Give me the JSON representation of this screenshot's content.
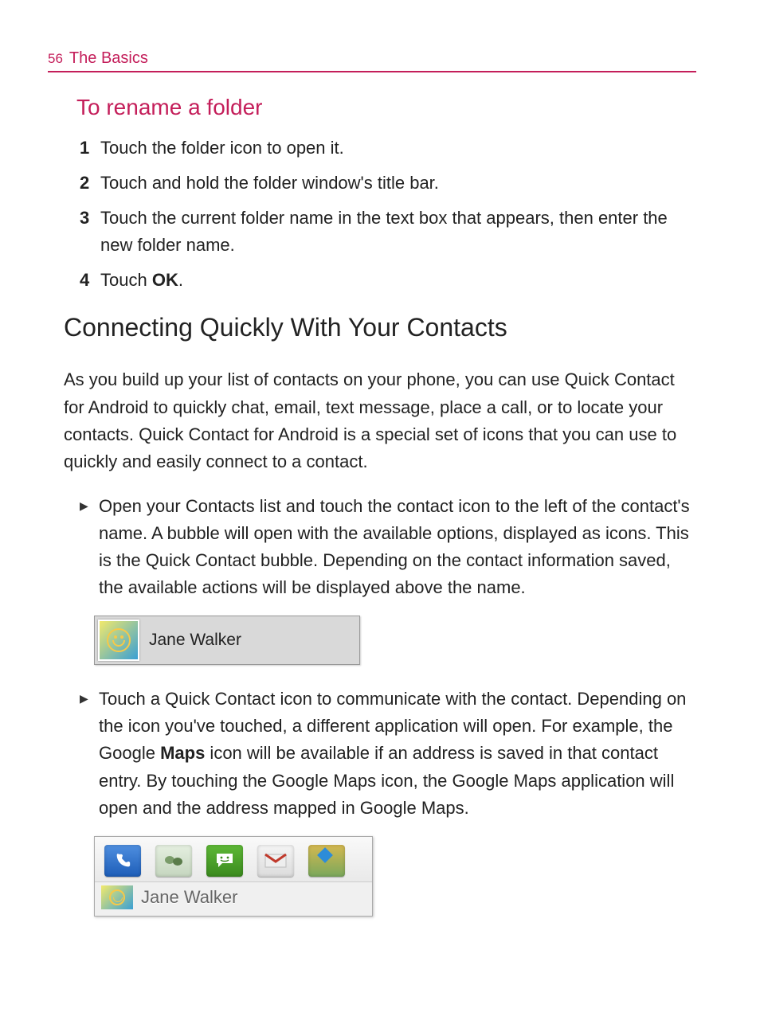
{
  "header": {
    "page_number": "56",
    "chapter": "The Basics"
  },
  "rename_folder": {
    "heading": "To rename a folder",
    "steps": [
      {
        "n": "1",
        "text": "Touch the folder icon to open it."
      },
      {
        "n": "2",
        "text": "Touch and hold the folder window's title bar."
      },
      {
        "n": "3",
        "text": "Touch the current folder name in the text box that appears, then enter the new folder name."
      },
      {
        "n": "4",
        "prefix": "Touch ",
        "bold": "OK",
        "suffix": "."
      }
    ]
  },
  "quick_contact": {
    "heading": "Connecting Quickly With Your Contacts",
    "intro": "As you build up your list of contacts on your phone, you can use Quick Contact for Android to quickly chat, email, text message, place a call, or to locate your contacts. Quick Contact for Android is a special set of icons that you can use to quickly and easily connect to a contact.",
    "bullet1": "Open your Contacts list and touch the contact icon to the left of the contact's name. A bubble will open with the available options, displayed as icons. This is the Quick Contact bubble. Depending on the contact information saved, the available actions will be displayed above the name.",
    "contact_example_name": "Jane Walker",
    "bullet2_pre": "Touch a Quick Contact icon to communicate with the contact. Depending on the icon you've touched, a different application will open. For example, the Google ",
    "bullet2_bold": "Maps",
    "bullet2_post": " icon will be available if an address is saved in that contact entry. By touching the Google Maps icon, the Google Maps application will open and the address mapped in Google Maps.",
    "bubble_icons": [
      "phone",
      "talk",
      "messaging",
      "gmail",
      "maps"
    ],
    "bubble_name": "Jane Walker"
  }
}
